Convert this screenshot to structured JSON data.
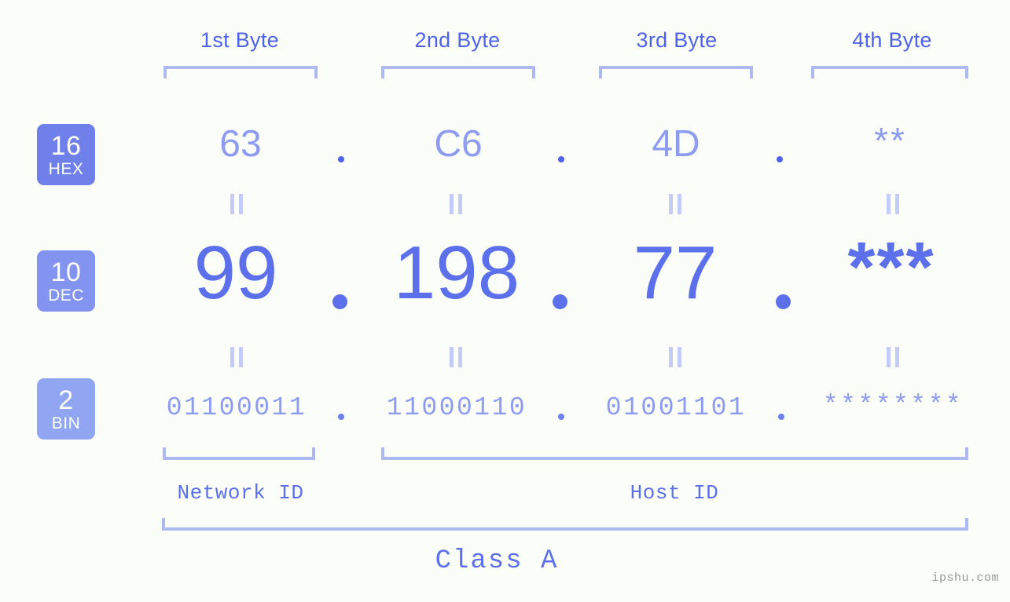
{
  "page": {
    "background_color": "#fbfdf8",
    "accent_color": "#5b70ea",
    "light_accent_color": "#8d9cf0",
    "bracket_color": "#aeb9f2",
    "watermark": "ipshu.com"
  },
  "byte_headers": [
    {
      "label": "1st Byte"
    },
    {
      "label": "2nd Byte"
    },
    {
      "label": "3rd Byte"
    },
    {
      "label": "4th Byte"
    }
  ],
  "rows": [
    {
      "badge_number": "16",
      "badge_name": "HEX",
      "badge_color": "#6f80ea",
      "base": 16,
      "values": [
        "63",
        "C6",
        "4D",
        "**"
      ]
    },
    {
      "badge_number": "10",
      "badge_name": "DEC",
      "badge_color": "#8294f0",
      "base": 10,
      "values": [
        "99",
        "198",
        "77",
        "***"
      ]
    },
    {
      "badge_number": "2",
      "badge_name": "BIN",
      "badge_color": "#90a6f2",
      "base": 2,
      "values": [
        "01100011",
        "11000110",
        "01001101",
        "********"
      ]
    }
  ],
  "separators": {
    "hex": [
      ".",
      ".",
      "."
    ],
    "dec": [
      ".",
      ".",
      "."
    ],
    "bin": [
      ".",
      ".",
      "."
    ]
  },
  "footer": {
    "network_id_label": "Network ID",
    "host_id_label": "Host ID",
    "class_label": "Class A"
  },
  "ip_address": {
    "dec": "99.198.77.***",
    "hex": "63.C6.4D.**",
    "bin": "01100011.11000110.01001101.********"
  }
}
